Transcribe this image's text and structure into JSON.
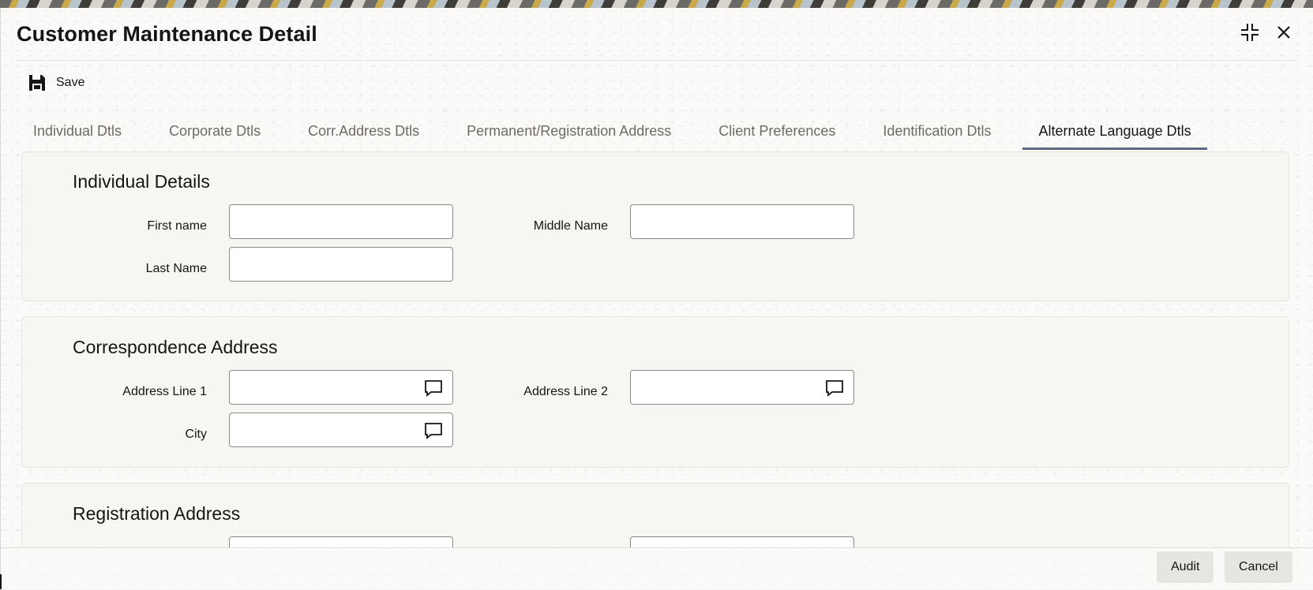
{
  "window": {
    "title": "Customer Maintenance Detail"
  },
  "toolbar": {
    "save_label": "Save"
  },
  "tabs": [
    {
      "label": "Individual Dtls",
      "active": false
    },
    {
      "label": "Corporate Dtls",
      "active": false
    },
    {
      "label": "Corr.Address Dtls",
      "active": false
    },
    {
      "label": "Permanent/Registration Address",
      "active": false
    },
    {
      "label": "Client Preferences",
      "active": false
    },
    {
      "label": "Identification Dtls",
      "active": false
    },
    {
      "label": "Alternate Language Dtls",
      "active": true
    }
  ],
  "sections": {
    "individual": {
      "title": "Individual Details",
      "first_name": {
        "label": "First name",
        "value": ""
      },
      "middle_name": {
        "label": "Middle Name",
        "value": ""
      },
      "last_name": {
        "label": "Last Name",
        "value": ""
      }
    },
    "correspondence": {
      "title": "Correspondence Address",
      "address_line_1": {
        "label": "Address Line 1",
        "value": ""
      },
      "address_line_2": {
        "label": "Address Line 2",
        "value": ""
      },
      "city": {
        "label": "City",
        "value": ""
      }
    },
    "registration": {
      "title": "Registration Address"
    }
  },
  "footer": {
    "audit_label": "Audit",
    "cancel_label": "Cancel"
  },
  "icons": {
    "save": "floppy-disk-icon",
    "restore": "collapse-icon",
    "close": "close-icon",
    "comment": "comment-icon"
  },
  "colors": {
    "active_tab_underline": "#5e6a80",
    "inactive_tab_text": "#6d6a66"
  }
}
